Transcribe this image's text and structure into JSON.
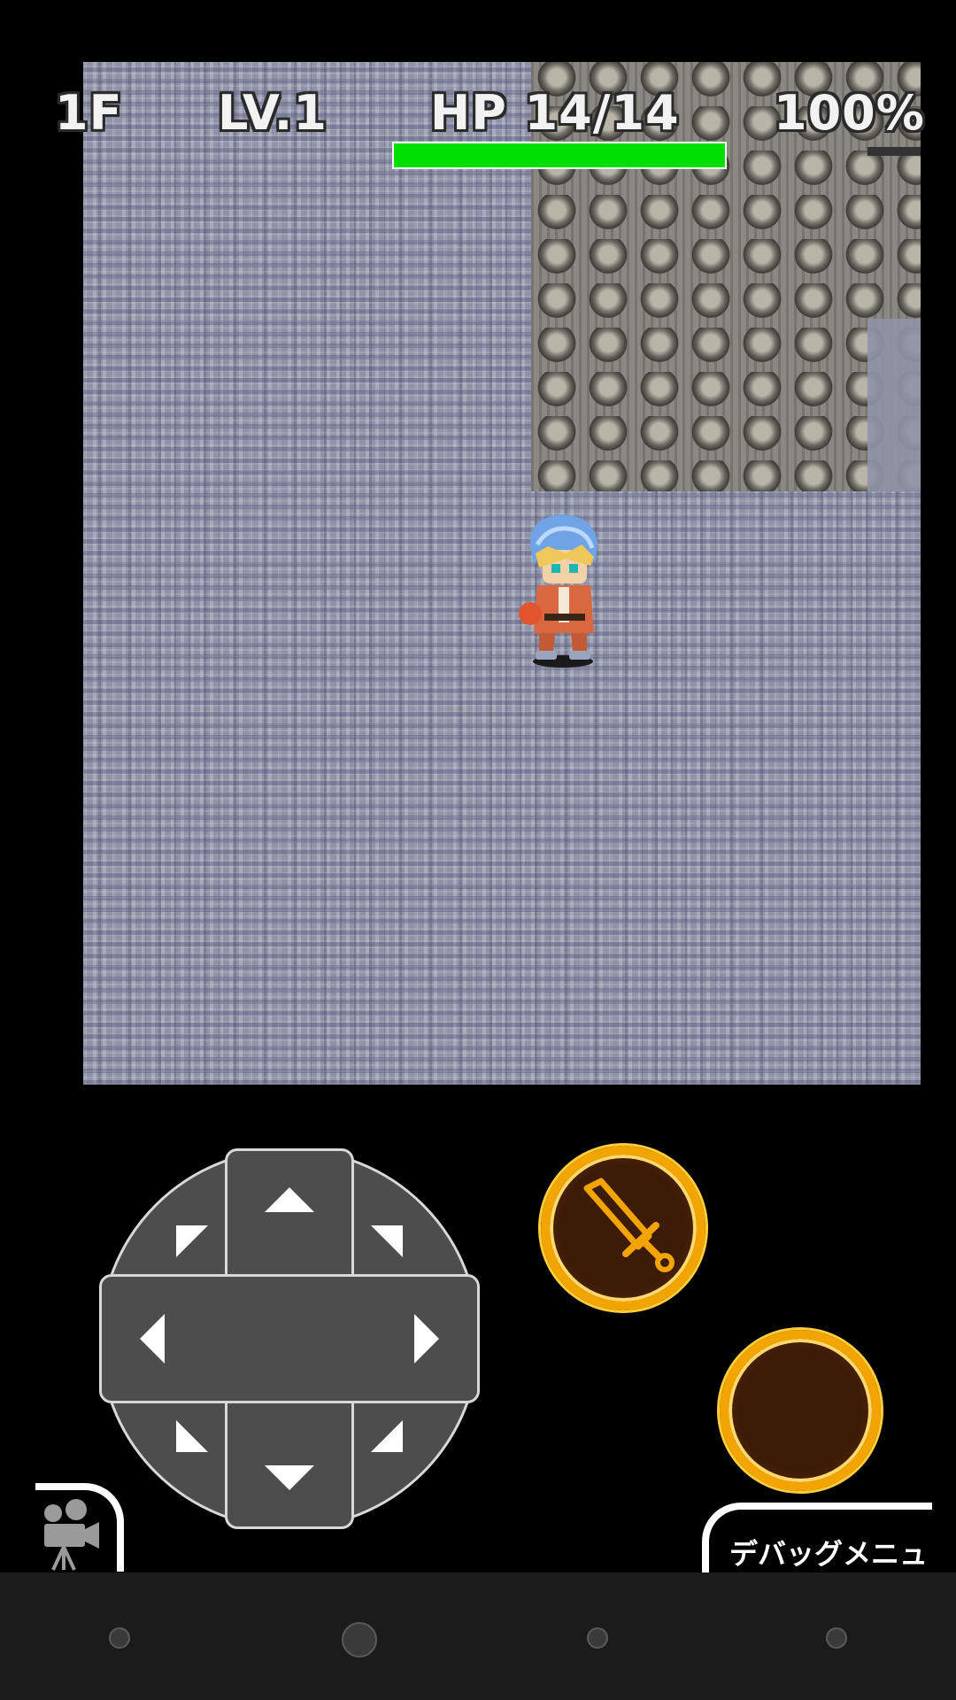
{
  "hud": {
    "floor": "1F",
    "level": "LV.1",
    "hp": "HP  14/14",
    "hunger": "100%",
    "hp_fraction": 1.0,
    "hp_color": "#00e000"
  },
  "controls": {
    "dpad": {
      "up": "arrow-up-icon",
      "down": "arrow-down-icon",
      "left": "arrow-left-icon",
      "right": "arrow-right-icon",
      "up_left": "arrow-up-left-icon",
      "up_right": "arrow-up-right-icon",
      "down_left": "arrow-down-left-icon",
      "down_right": "arrow-down-right-icon"
    },
    "attack_icon": "sword-icon",
    "accent_color": "#f2a400"
  },
  "tabs": {
    "camera_icon": "movie-camera-icon",
    "debug_label": "デバッグメニュ"
  },
  "navbar": {
    "buttons": [
      "nav-button-1",
      "nav-button-2",
      "nav-button-3",
      "nav-button-4"
    ]
  }
}
